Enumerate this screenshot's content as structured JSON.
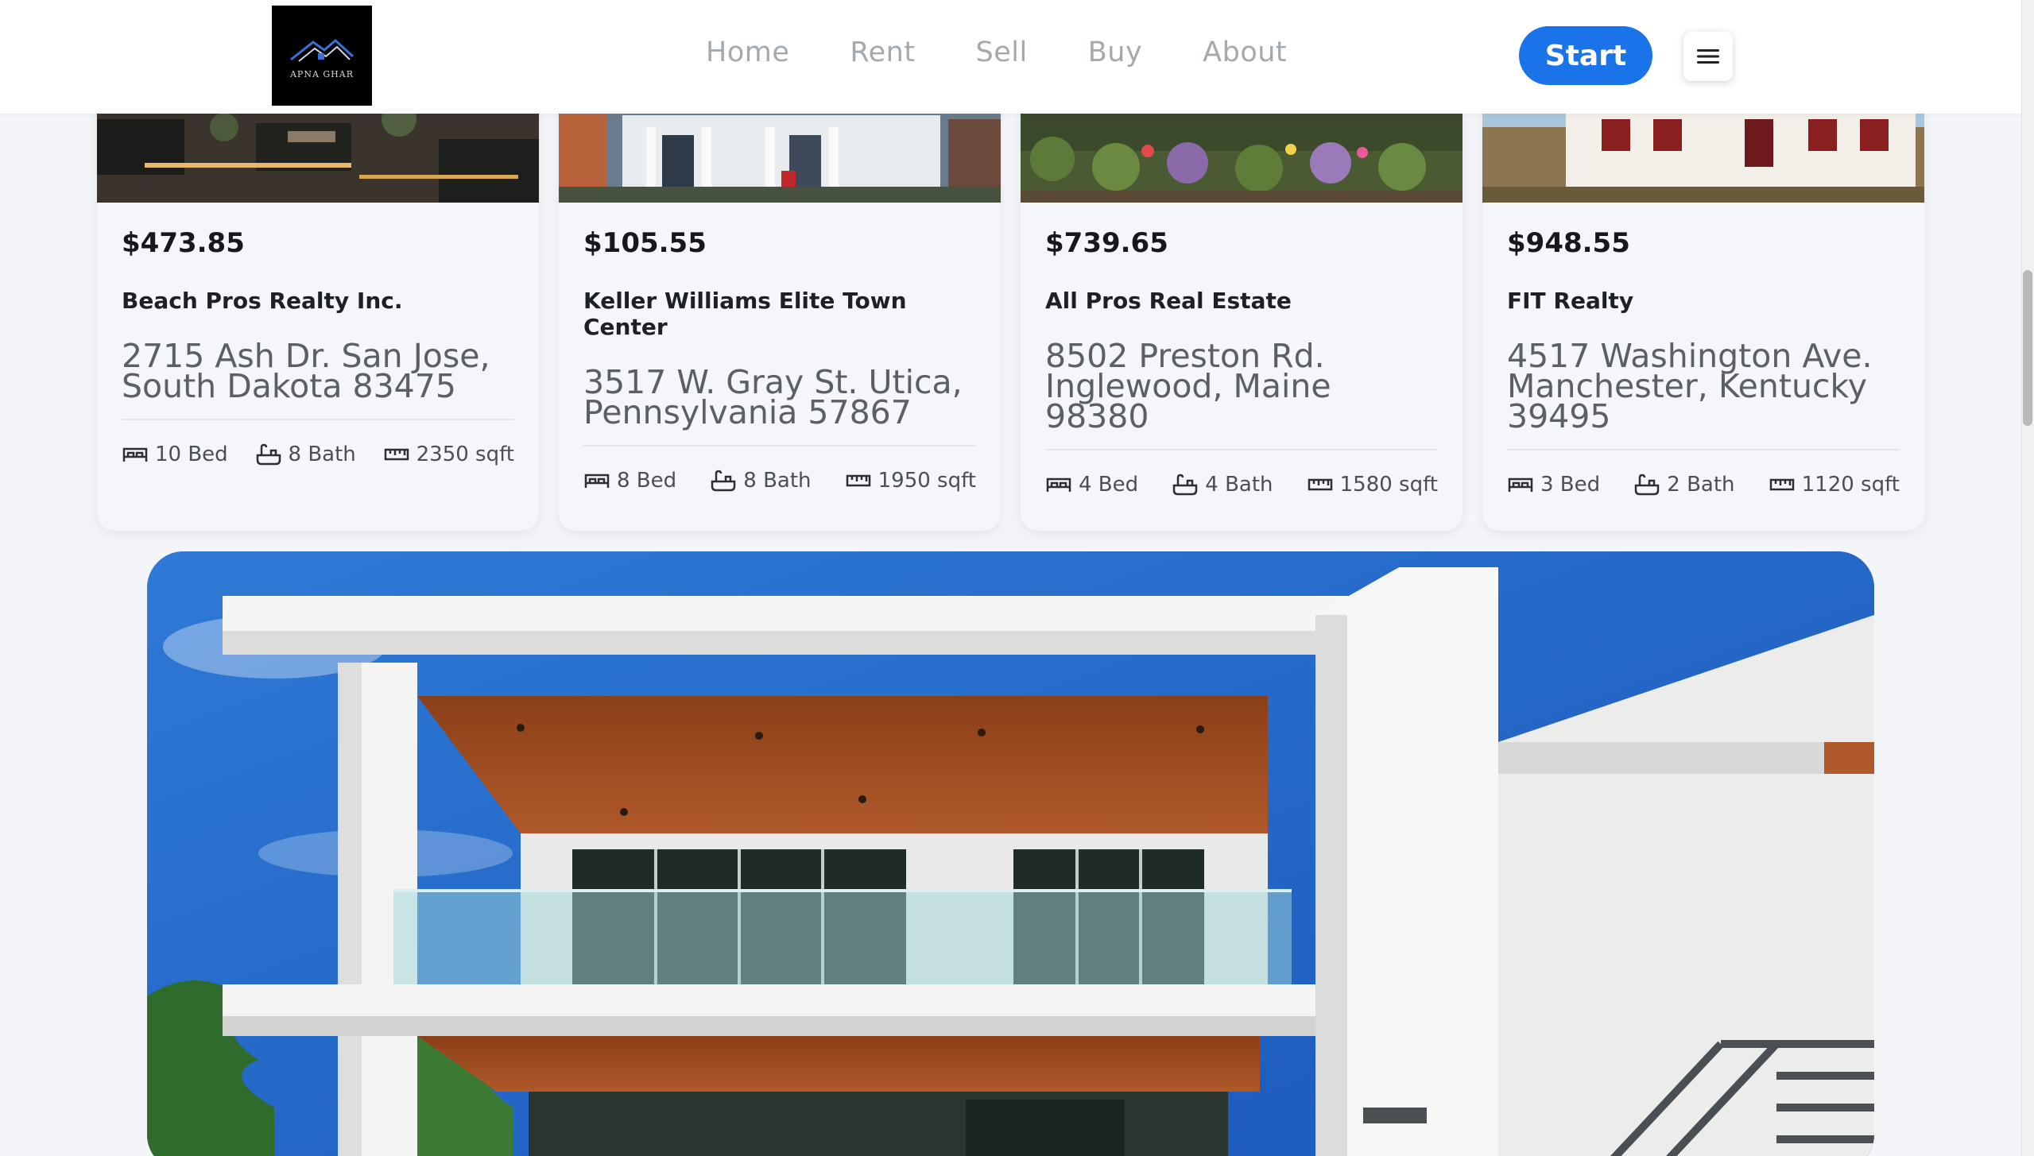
{
  "brand": {
    "logo_text": "APNA GHAR"
  },
  "nav": {
    "links": [
      "Home",
      "Rent",
      "Sell",
      "Buy",
      "About"
    ],
    "start_label": "Start"
  },
  "listings": [
    {
      "price": "$473.85",
      "agency": "Beach Pros Realty Inc.",
      "address": "2715 Ash Dr. San Jose, South Dakota 83475",
      "bed": "10 Bed",
      "bath": "8 Bath",
      "area": "2350 sqft"
    },
    {
      "price": "$105.55",
      "agency": "Keller Williams Elite Town Center",
      "address": "3517 W. Gray St. Utica, Pennsylvania 57867",
      "bed": "8 Bed",
      "bath": "8 Bath",
      "area": "1950 sqft"
    },
    {
      "price": "$739.65",
      "agency": "All Pros Real Estate",
      "address": "8502 Preston Rd. Inglewood, Maine 98380",
      "bed": "4 Bed",
      "bath": "4 Bath",
      "area": "1580 sqft"
    },
    {
      "price": "$948.55",
      "agency": "FIT Realty",
      "address": "4517 Washington Ave. Manchester, Kentucky 39495",
      "bed": "3 Bed",
      "bath": "2 Bath",
      "area": "1120 sqft"
    }
  ],
  "colors": {
    "accent": "#1a73e8",
    "background": "#f3f5f8"
  },
  "icons": [
    "bed-icon",
    "bath-icon",
    "ruler-icon",
    "hamburger-menu-icon"
  ]
}
